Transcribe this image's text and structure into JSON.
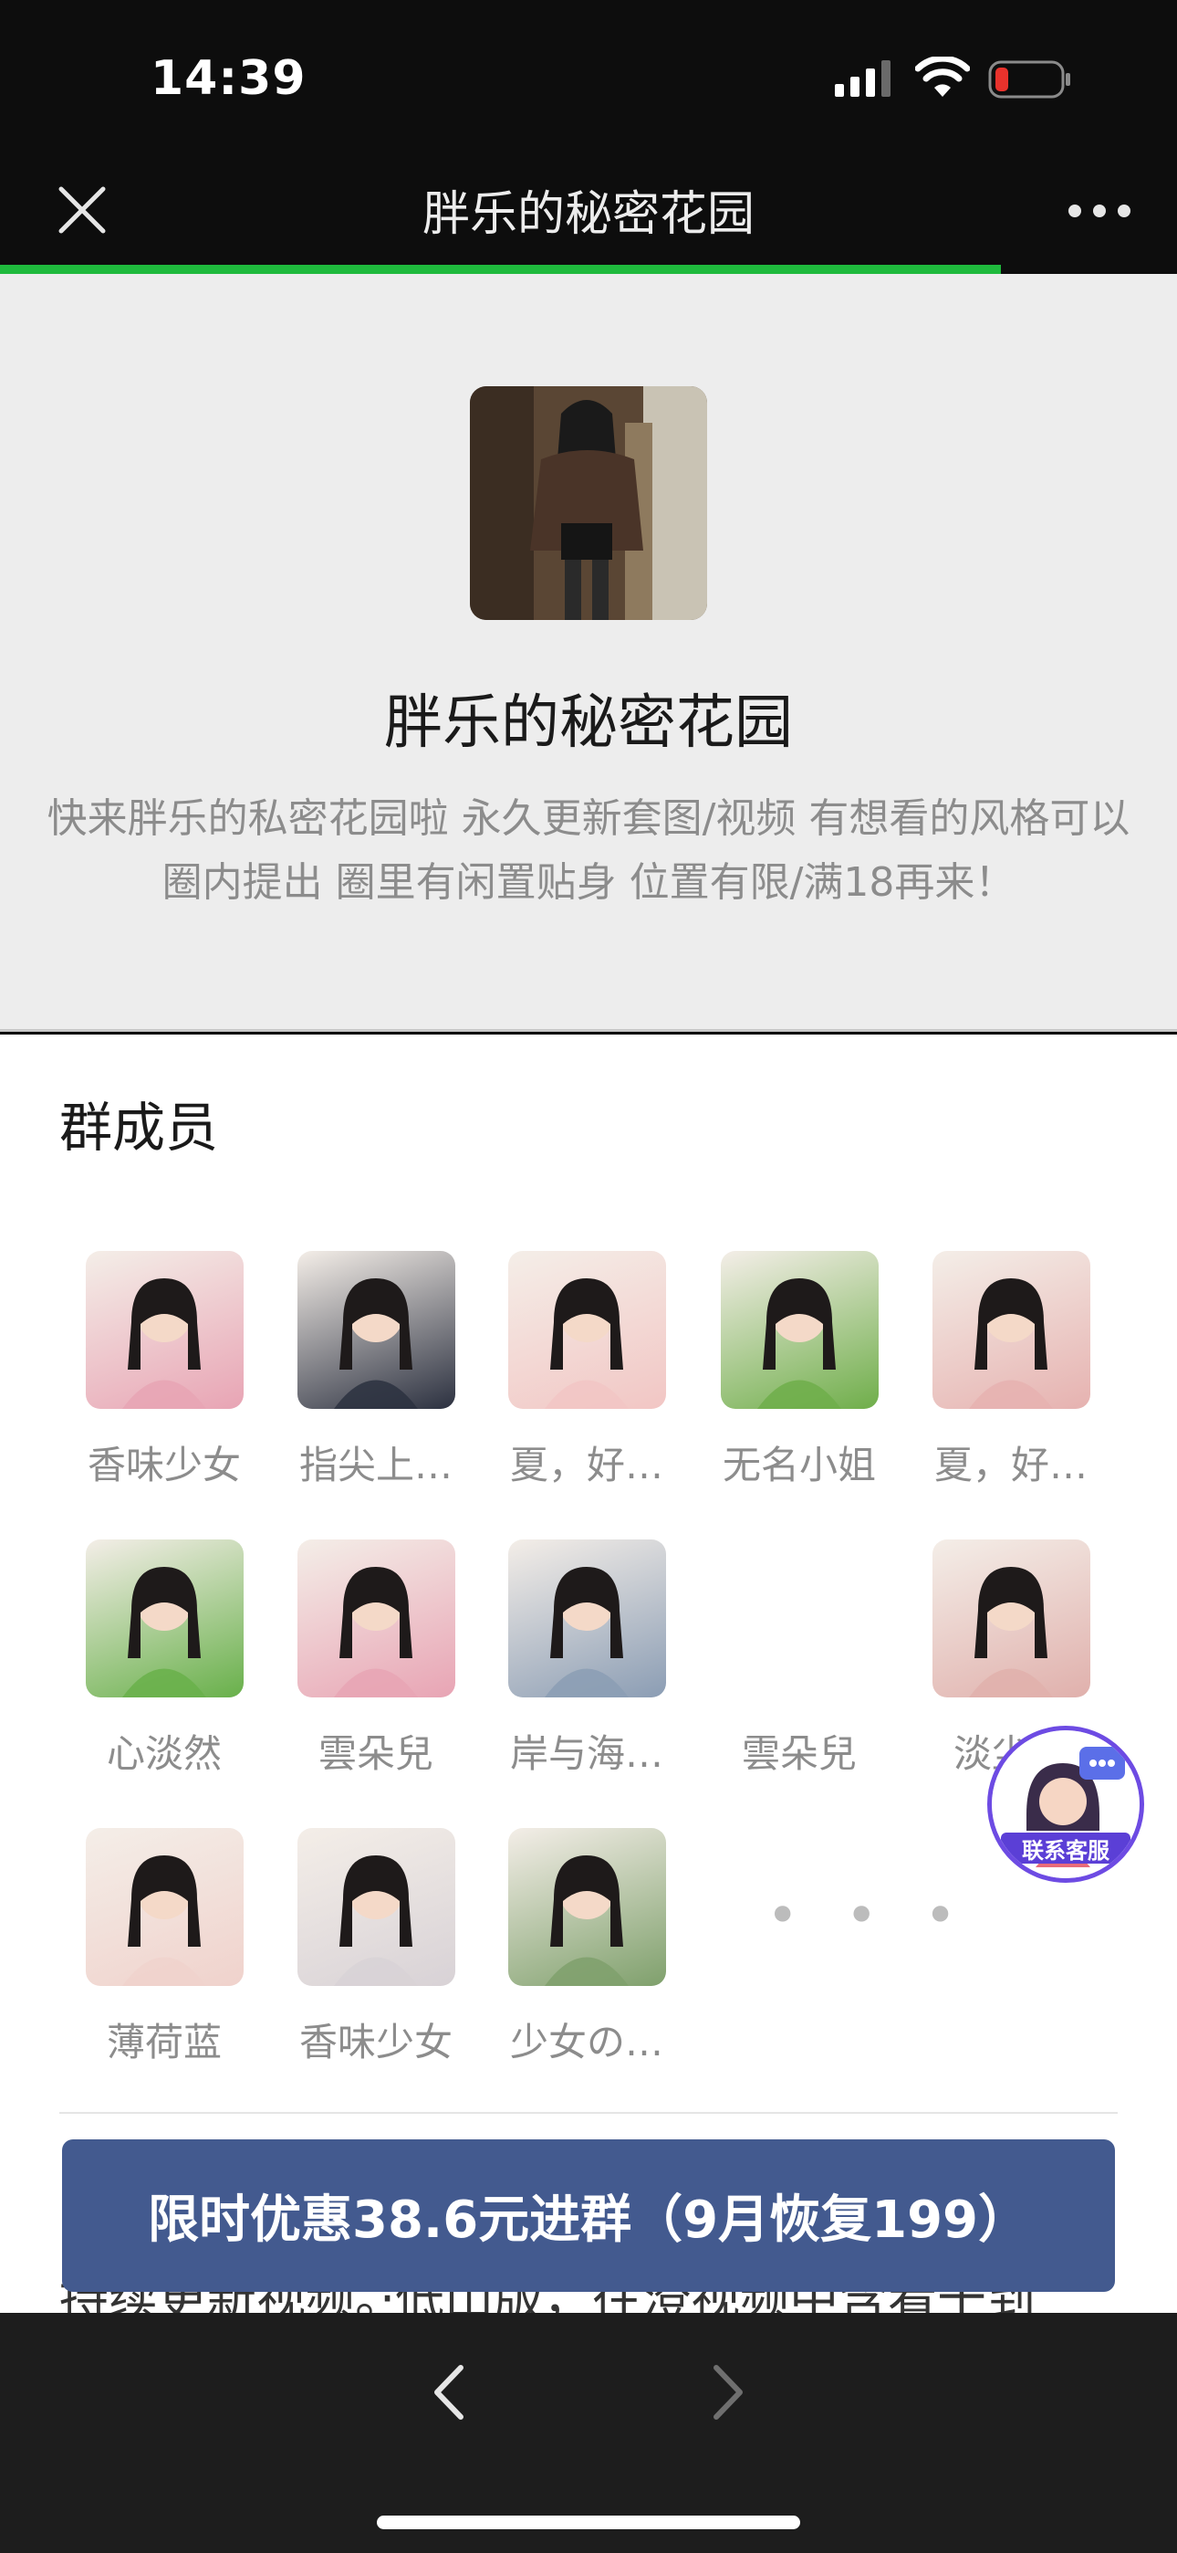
{
  "status_bar": {
    "time": "14:39"
  },
  "nav": {
    "title": "胖乐的秘密花园",
    "load_progress": 0.85
  },
  "header": {
    "group_name": "胖乐的秘密花园",
    "description_line1": "快来胖乐的私密花园啦 永久更新套图/视频 有想看的风格可以",
    "description_line2": "圈内提出 圈里有闲置贴身 位置有限/满18再来！"
  },
  "members": {
    "title": "群成员",
    "list": [
      {
        "name": "香味少女",
        "color": "#e8a4b4"
      },
      {
        "name": "指尖上…",
        "color": "#2c3140"
      },
      {
        "name": "夏，好…",
        "color": "#f2c6c4"
      },
      {
        "name": "无名小姐",
        "color": "#6fae4a"
      },
      {
        "name": "夏，好…",
        "color": "#e6b2b0"
      },
      {
        "name": "心淡然",
        "color": "#68b04a"
      },
      {
        "name": "雲朵兒",
        "color": "#e8a4b4"
      },
      {
        "name": "岸与海…",
        "color": "#8b9db4"
      },
      {
        "name": "雲朵兒",
        "color": ""
      },
      {
        "name": "淡尘…",
        "color": "#e0b0ac"
      },
      {
        "name": "薄荷蓝",
        "color": "#f0d2cc"
      },
      {
        "name": "香味少女",
        "color": "#d8d2d6"
      },
      {
        "name": "少女の…",
        "color": "#7fa06c"
      }
    ],
    "more": "• • •"
  },
  "cut_text": "持续更新视频。·低山版，往澄视频中含看干到",
  "join_button": {
    "label": "限时优惠38.6元进群（9月恢复199）"
  },
  "customer_service": {
    "label": "联系客服"
  }
}
